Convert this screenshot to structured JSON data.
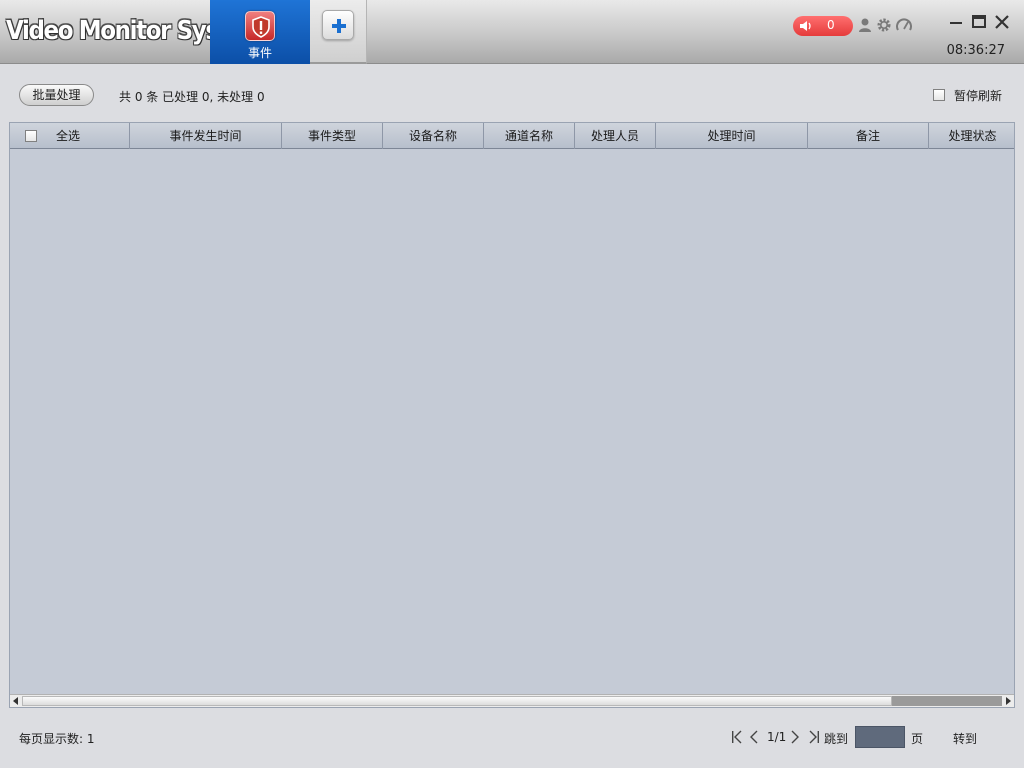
{
  "app": {
    "title": "Video Monitor System"
  },
  "tabs": [
    {
      "label": "事件",
      "icon": "alert-shield-icon",
      "active": true
    },
    {
      "label": "",
      "icon": "plus-icon",
      "active": false
    }
  ],
  "header": {
    "alarm_count": "0",
    "clock": "08:36:27",
    "icons": [
      "speaker-icon",
      "user-icon",
      "gear-icon",
      "gauge-icon",
      "minimize-icon",
      "maximize-icon",
      "close-icon"
    ]
  },
  "toolbar": {
    "batch_label": "批量处理",
    "summary": "共 0 条 已处理 0, 未处理 0",
    "pause_label": "暂停刷新"
  },
  "table": {
    "columns": [
      "全选",
      "事件发生时间",
      "事件类型",
      "设备名称",
      "通道名称",
      "处理人员",
      "处理时间",
      "备注",
      "处理状态"
    ],
    "rows": []
  },
  "footer": {
    "per_page": "每页显示数: 1",
    "page_info": "1/1",
    "jump_label": "跳到",
    "jump_value": "",
    "page_label": "页",
    "goto_label": "转到"
  },
  "colors": {
    "accent": "#0c4fa7",
    "alarm": "#e53b3b",
    "table_bg": "#c5cbd6"
  }
}
